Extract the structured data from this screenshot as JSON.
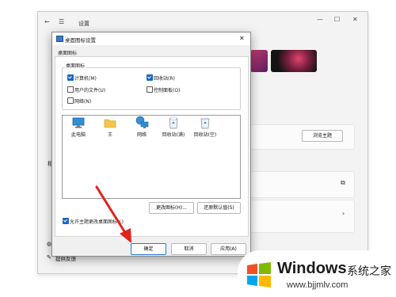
{
  "settings": {
    "title": "设置",
    "section_fragment": "相",
    "browse_theme_button": "浏览主题",
    "feedback_link": "提供反馈"
  },
  "dialog": {
    "title": "桌面图标设置",
    "tab": "桌面图标",
    "group_label": "桌面图标",
    "checkboxes": [
      {
        "label": "计算机(M)",
        "checked": true
      },
      {
        "label": "回收站(R)",
        "checked": true
      },
      {
        "label": "用户的文件(U)",
        "checked": false
      },
      {
        "label": "控制面板(O)",
        "checked": false
      },
      {
        "label": "网络(N)",
        "checked": false
      }
    ],
    "icons": [
      {
        "label": "此电脑",
        "icon": "computer-icon"
      },
      {
        "label": "王",
        "icon": "folder-icon"
      },
      {
        "label": "网络",
        "icon": "network-icon"
      },
      {
        "label": "回收站(满)",
        "icon": "recycle-bin-full-icon"
      },
      {
        "label": "回收站(空)",
        "icon": "recycle-bin-empty-icon"
      }
    ],
    "change_icon_button": "更改图标(H)...",
    "restore_default_button": "还原默认值(S)",
    "allow_theme_checkbox": {
      "label": "允许主题更改桌面图标(L)",
      "checked": true
    },
    "ok_button": "确定",
    "cancel_button": "取消",
    "apply_button": "应用(A)"
  },
  "watermark": {
    "brand": "Windows",
    "brand_cn": "系统之家",
    "url": "www.bjjmlv.com"
  },
  "colors": {
    "accent": "#1a66c9",
    "arrow": "#e0241b",
    "win_red": "#f25022",
    "win_green": "#7fba00",
    "win_blue": "#00a4ef",
    "win_yellow": "#ffb900"
  }
}
